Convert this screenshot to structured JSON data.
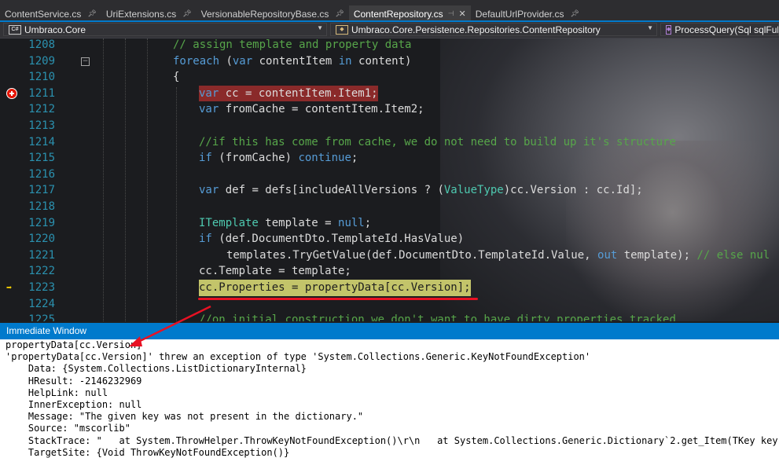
{
  "tabs": [
    {
      "label": "ContentService.cs",
      "active": false
    },
    {
      "label": "UriExtensions.cs",
      "active": false
    },
    {
      "label": "VersionableRepositoryBase.cs",
      "active": false
    },
    {
      "label": "ContentRepository.cs",
      "active": true
    },
    {
      "label": "DefaultUrlProvider.cs",
      "active": false
    }
  ],
  "tab_pin_icon": "pin-icon",
  "nav": {
    "project": "Umbraco.Core",
    "project_icon_text": "C#",
    "type": "Umbraco.Core.Persistence.Repositories.ContentRepository",
    "member": "ProcessQuery(Sql sqlFull,"
  },
  "code_lines": [
    {
      "n": "1208"
    },
    {
      "n": "1209"
    },
    {
      "n": "1210"
    },
    {
      "n": "1211"
    },
    {
      "n": "1212"
    },
    {
      "n": "1213"
    },
    {
      "n": "1214"
    },
    {
      "n": "1215"
    },
    {
      "n": "1216"
    },
    {
      "n": "1217"
    },
    {
      "n": "1218"
    },
    {
      "n": "1219"
    },
    {
      "n": "1220"
    },
    {
      "n": "1221"
    },
    {
      "n": "1222"
    },
    {
      "n": "1223"
    },
    {
      "n": "1224"
    },
    {
      "n": "1225"
    }
  ],
  "code": {
    "l1208": "// assign template and property data",
    "l1209_kw": "foreach",
    "l1209_a": " (",
    "l1209_kw2": "var",
    "l1209_b": " contentItem ",
    "l1209_kw3": "in",
    "l1209_c": " content)",
    "l1210": "{",
    "l1211_kw": "var",
    "l1211_rest": " cc = contentItem.Item1;",
    "l1212_kw": "var",
    "l1212_rest": " fromCache = contentItem.Item2;",
    "l1214": "//if this has come from cache, we do not need to build up it's structure",
    "l1215_kw": "if",
    "l1215_a": " (fromCache) ",
    "l1215_kw2": "continue",
    "l1215_b": ";",
    "l1217_kw": "var",
    "l1217_a": " def = defs[includeAllVersions ? (",
    "l1217_ty": "ValueType",
    "l1217_b": ")cc.Version : cc.Id];",
    "l1219_ty": "ITemplate",
    "l1219_a": " template = ",
    "l1219_kw": "null",
    "l1219_b": ";",
    "l1220_kw": "if",
    "l1220_rest": " (def.DocumentDto.TemplateId.HasValue)",
    "l1221_a": "templates.TryGetValue(def.DocumentDto.TemplateId.Value, ",
    "l1221_kw": "out",
    "l1221_b": " template); ",
    "l1221_cm": "// else nul",
    "l1222": "cc.Template = template;",
    "l1223": "cc.Properties = propertyData[cc.Version];",
    "l1225": "//on initial construction we don't want to have dirty properties tracked"
  },
  "immediate": {
    "title": "Immediate Window",
    "lines": [
      "propertyData[cc.Version]",
      "'propertyData[cc.Version]' threw an exception of type 'System.Collections.Generic.KeyNotFoundException'",
      "    Data: {System.Collections.ListDictionaryInternal}",
      "    HResult: -2146232969",
      "    HelpLink: null",
      "    InnerException: null",
      "    Message: \"The given key was not present in the dictionary.\"",
      "    Source: \"mscorlib\"",
      "    StackTrace: \"   at System.ThrowHelper.ThrowKeyNotFoundException()\\r\\n   at System.Collections.Generic.Dictionary`2.get_Item(TKey key)\"",
      "    TargetSite: {Void ThrowKeyNotFoundException()}"
    ]
  },
  "colors": {
    "accent": "#007acc",
    "keyword": "#569cd6",
    "comment": "#57a64a",
    "type": "#4ec9b0",
    "line_number": "#2b91af",
    "breakpoint": "#e51400",
    "current_line_highlight": "#c3c46a",
    "annotation": "#e81123"
  }
}
